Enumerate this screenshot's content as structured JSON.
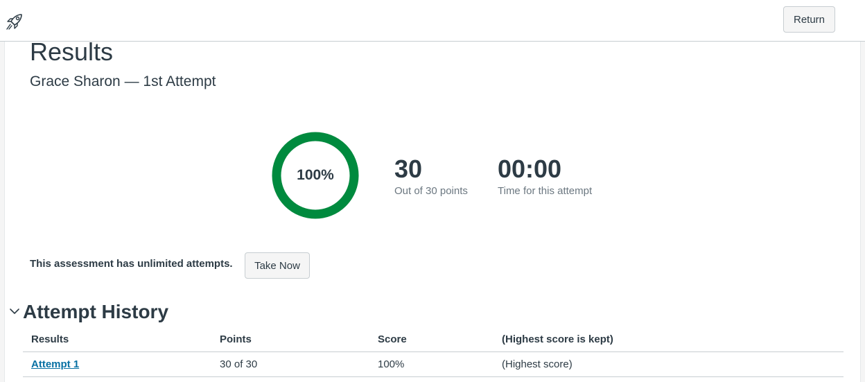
{
  "header": {
    "logo_icon": "rocket-icon",
    "return_label": "Return"
  },
  "results": {
    "title": "Results",
    "subtitle": "Grace Sharon — 1st Attempt",
    "score_percent_label": "100%",
    "score_fraction": 1.0,
    "points_value": "30",
    "points_caption": "Out of 30 points",
    "time_value": "00:00",
    "time_caption": "Time for this attempt"
  },
  "attempts": {
    "note": "This assessment has unlimited attempts.",
    "take_now_label": "Take Now"
  },
  "history": {
    "title": "Attempt History",
    "toggle_icon": "chevron-down-icon",
    "columns": [
      "Results",
      "Points",
      "Score",
      "(Highest score is kept)"
    ],
    "rows": [
      {
        "results": "Attempt 1",
        "points": "30 of 30",
        "score": "100%",
        "note": "(Highest score)"
      }
    ]
  },
  "colors": {
    "success": "#008a3e",
    "link": "#0770a3",
    "text": "#2d3b45",
    "muted": "#6b7780"
  }
}
